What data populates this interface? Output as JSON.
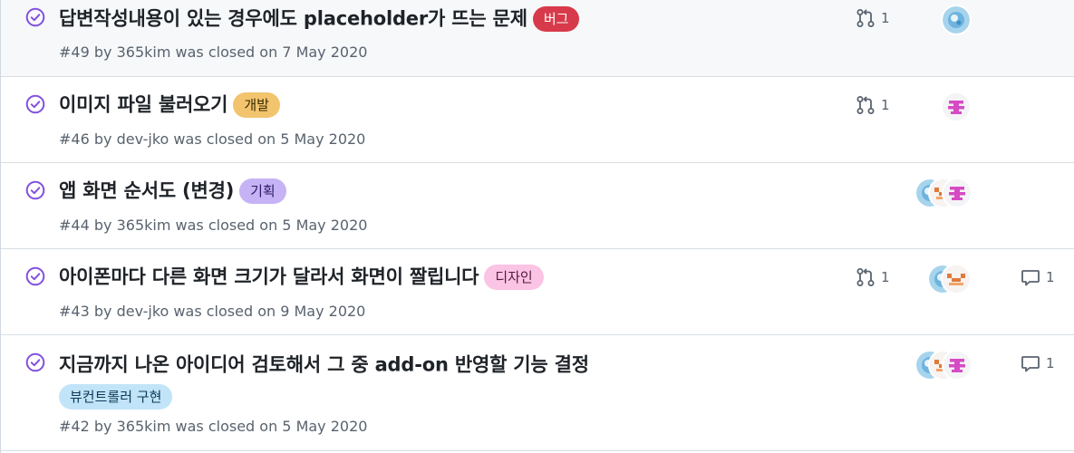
{
  "colors": {
    "closed_purple": "#8250df",
    "meta_gray": "#59636e",
    "label_bug": "#d73a4a",
    "label_dev": "#f2c46d",
    "label_plan": "#c5b3f5",
    "label_design": "#fbc3e4",
    "label_viewcontroller": "#c2e4f8"
  },
  "issues": [
    {
      "title": "답변작성내용이 있는 경우에도 placeholder가 뜨는 문제",
      "labels": [
        {
          "text": "버그"
        }
      ],
      "number": "#49",
      "by": "by",
      "author": "365kim",
      "closed_text": "was closed on 7 May 2020",
      "linked_pr_count": "1",
      "comment_count": null,
      "assignees": [
        "blue-avatar"
      ]
    },
    {
      "title": "이미지 파일 불러오기",
      "labels": [
        {
          "text": "개발"
        }
      ],
      "number": "#46",
      "by": "by",
      "author": "dev-jko",
      "closed_text": "was closed on 5 May 2020",
      "linked_pr_count": "1",
      "comment_count": null,
      "assignees": [
        "pink-avatar"
      ]
    },
    {
      "title": "앱 화면 순서도 (변경)",
      "labels": [
        {
          "text": "기획"
        }
      ],
      "number": "#44",
      "by": "by",
      "author": "365kim",
      "closed_text": "was closed on 5 May 2020",
      "linked_pr_count": null,
      "comment_count": null,
      "assignees": [
        "blue-avatar",
        "orange-avatar",
        "pink-avatar"
      ]
    },
    {
      "title": "아이폰마다 다른 화면 크기가 달라서 화면이 짤립니다",
      "labels": [
        {
          "text": "디자인"
        }
      ],
      "number": "#43",
      "by": "by",
      "author": "dev-jko",
      "closed_text": "was closed on 9 May 2020",
      "linked_pr_count": "1",
      "comment_count": "1",
      "assignees": [
        "blue-avatar",
        "orange-avatar"
      ]
    },
    {
      "title": "지금까지 나온 아이디어 검토해서 그 중 add-on 반영할 기능 결정",
      "labels": [
        {
          "text": "뷰컨트롤러 구현"
        }
      ],
      "number": "#42",
      "by": "by",
      "author": "365kim",
      "closed_text": "was closed on 5 May 2020",
      "linked_pr_count": null,
      "comment_count": "1",
      "assignees": [
        "blue-avatar",
        "orange-avatar",
        "pink-avatar"
      ]
    }
  ]
}
